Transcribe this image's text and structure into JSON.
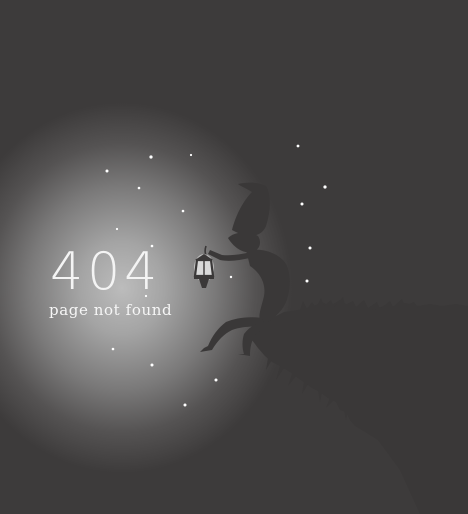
{
  "error": {
    "code": "404",
    "message": "page not found"
  },
  "illustration": {
    "subject": "silhouette-figure-with-lantern-on-cliff",
    "background_color": "#3d3b3b",
    "glow_color": "#bcbcbc",
    "silhouette_color": "#3a3838",
    "lantern_glow_color": "#e6e6e6"
  }
}
